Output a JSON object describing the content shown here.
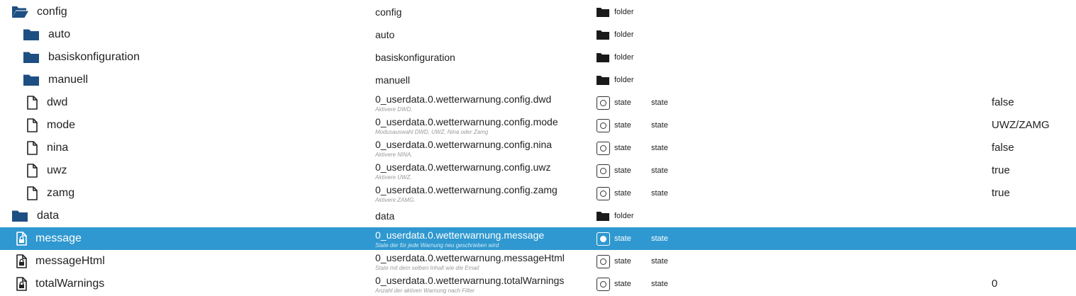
{
  "colors": {
    "folder_icon": "#1d4f82",
    "selected_row_bg": "#2f98d0",
    "selected_text": "#ffffff",
    "text": "#222222",
    "description_text": "#9a9a9a"
  },
  "rows": [
    {
      "name": "config",
      "icon": "folder-open-icon",
      "id": "config",
      "desc": "",
      "type": "folder",
      "role": "",
      "value": "",
      "selected": false
    },
    {
      "name": "auto",
      "icon": "folder-icon",
      "id": "auto",
      "desc": "",
      "type": "folder",
      "role": "",
      "value": "",
      "selected": false
    },
    {
      "name": "basiskonfiguration",
      "icon": "folder-icon",
      "id": "basiskonfiguration",
      "desc": "",
      "type": "folder",
      "role": "",
      "value": "",
      "selected": false
    },
    {
      "name": "manuell",
      "icon": "folder-icon",
      "id": "manuell",
      "desc": "",
      "type": "folder",
      "role": "",
      "value": "",
      "selected": false
    },
    {
      "name": "dwd",
      "icon": "file-icon",
      "id": "0_userdata.0.wetterwarnung.config.dwd",
      "desc": "Aktivere DWD.",
      "type": "state",
      "role": "state",
      "value": "false",
      "selected": false
    },
    {
      "name": "mode",
      "icon": "file-icon",
      "id": "0_userdata.0.wetterwarnung.config.mode",
      "desc": "Modusauswahl DWD, UWZ, Nina oder Zamg",
      "type": "state",
      "role": "state",
      "value": "UWZ/ZAMG",
      "selected": false
    },
    {
      "name": "nina",
      "icon": "file-icon",
      "id": "0_userdata.0.wetterwarnung.config.nina",
      "desc": "Aktivere NINA.",
      "type": "state",
      "role": "state",
      "value": "false",
      "selected": false
    },
    {
      "name": "uwz",
      "icon": "file-icon",
      "id": "0_userdata.0.wetterwarnung.config.uwz",
      "desc": "Aktivere UWZ.",
      "type": "state",
      "role": "state",
      "value": "true",
      "selected": false
    },
    {
      "name": "zamg",
      "icon": "file-icon",
      "id": "0_userdata.0.wetterwarnung.config.zamg",
      "desc": "Aktivere ZAMG.",
      "type": "state",
      "role": "state",
      "value": "true",
      "selected": false
    },
    {
      "name": "data",
      "icon": "folder-icon",
      "id": "data",
      "desc": "",
      "type": "folder",
      "role": "",
      "value": "",
      "selected": false
    },
    {
      "name": "message",
      "icon": "file-lock-icon",
      "id": "0_userdata.0.wetterwarnung.message",
      "desc": "State der für jede Warnung neu geschrieben wird",
      "type": "state",
      "role": "state",
      "value": "",
      "selected": true
    },
    {
      "name": "messageHtml",
      "icon": "file-lock-icon",
      "id": "0_userdata.0.wetterwarnung.messageHtml",
      "desc": "State mit dem selben Inhalt wie die Email",
      "type": "state",
      "role": "state",
      "value": "",
      "selected": false
    },
    {
      "name": "totalWarnings",
      "icon": "file-lock-icon",
      "id": "0_userdata.0.wetterwarnung.totalWarnings",
      "desc": "Anzahl der aktiven Warnung nach Filter",
      "type": "state",
      "role": "state",
      "value": "0",
      "selected": false
    }
  ]
}
